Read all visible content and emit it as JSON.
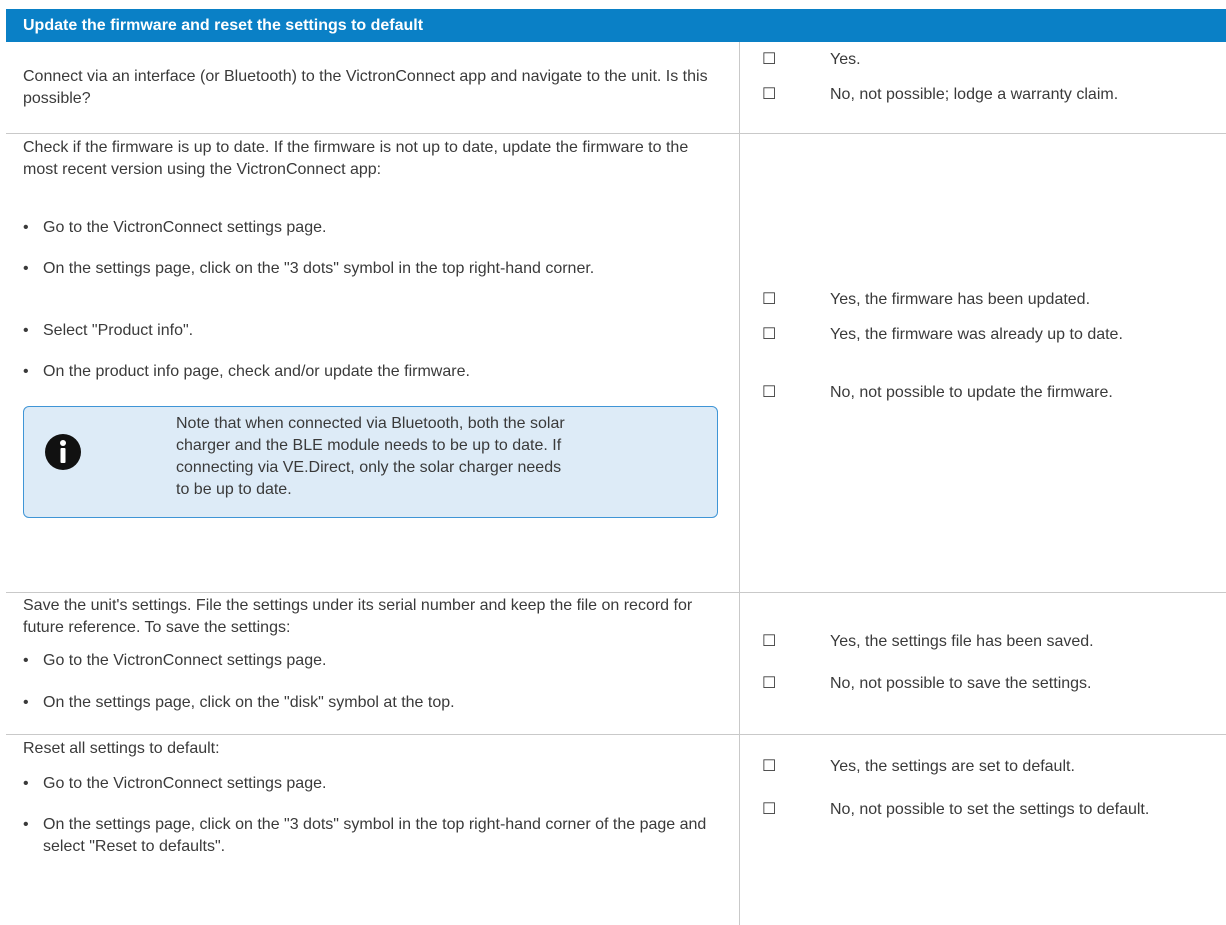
{
  "header": {
    "title": "Update the firmware and reset the settings to default"
  },
  "rows": [
    {
      "text": "Connect via an interface (or Bluetooth) to the VictronConnect app and navigate to the unit. Is this possible?",
      "options": [
        {
          "box": "☐",
          "label": "Yes."
        },
        {
          "box": "☐",
          "label": "No, not possible; lodge a warranty claim."
        }
      ]
    },
    {
      "text": "Check if the firmware is up to date. If the firmware is not up to date, update the firmware to the most recent version using the VictronConnect app:",
      "bullets": [
        "Go to the VictronConnect settings page.",
        "On the settings page, click on the \"3 dots\" symbol in the top right-hand corner.",
        "Select \"Product info\".",
        "On the product info page, check and/or update the firmware."
      ],
      "note": {
        "icon": "info-icon",
        "text": "Note that when connected via Bluetooth, both the solar charger and the BLE module needs to be up to date. If connecting via VE.Direct, only the solar charger needs to be up to date."
      },
      "options": [
        {
          "box": "☐",
          "label": "Yes, the firmware has been updated."
        },
        {
          "box": "☐",
          "label": "Yes, the firmware was already up to date."
        },
        {
          "box": "☐",
          "label": "No, not possible to update the firmware."
        }
      ]
    },
    {
      "text": "Save the unit's settings. File the settings under its serial number and keep the file on record for future reference. To save the settings:",
      "bullets": [
        "Go to the VictronConnect settings page.",
        "On the settings page, click on the \"disk\" symbol at the top."
      ],
      "options": [
        {
          "box": "☐",
          "label": "Yes, the settings file has been saved."
        },
        {
          "box": "☐",
          "label": "No, not possible to save the settings."
        }
      ]
    },
    {
      "text": "Reset all settings to default:",
      "bullets": [
        "Go to the VictronConnect settings page.",
        "On the settings page, click on the \"3 dots\" symbol in the top right-hand corner of the page and select \"Reset to defaults\"."
      ],
      "options": [
        {
          "box": "☐",
          "label": "Yes, the settings are set to default."
        },
        {
          "box": "☐",
          "label": "No, not possible to set the settings to default."
        }
      ]
    }
  ],
  "bullet_char": "•",
  "colors": {
    "header_bg": "#0a80c6",
    "note_bg": "#ddebf7",
    "note_border": "#3f95d6",
    "grid": "#c9c9c9"
  }
}
